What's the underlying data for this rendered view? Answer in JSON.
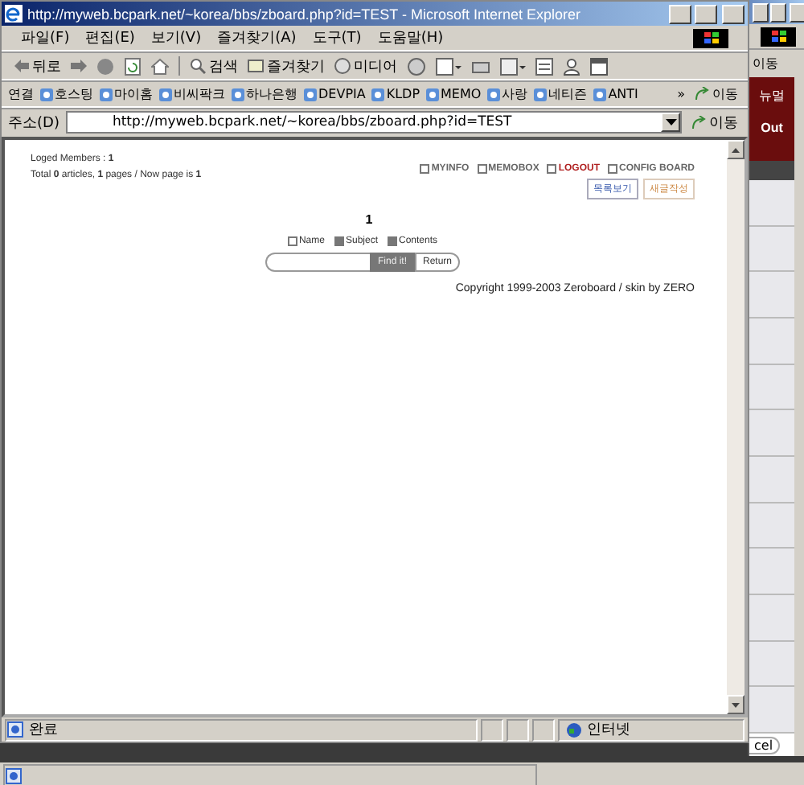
{
  "window": {
    "title": "http://myweb.bcpark.net/~korea/bbs/zboard.php?id=TEST - Microsoft Internet Explorer"
  },
  "menu": [
    "파일(F)",
    "편집(E)",
    "보기(V)",
    "즐겨찾기(A)",
    "도구(T)",
    "도움말(H)"
  ],
  "toolbar": {
    "back": "뒤로",
    "search": "검색",
    "favorites": "즐겨찾기",
    "media": "미디어"
  },
  "links": {
    "label": "연결",
    "items": [
      "호스팅",
      "마이홈",
      "비씨팍크",
      "하나은행",
      "DEVPIA",
      "KLDP",
      "MEMO",
      "사랑",
      "네티즌",
      "ANTI"
    ],
    "more": "»",
    "go": "이동"
  },
  "address": {
    "label": "주소(D)",
    "value": "http://myweb.bcpark.net/~korea/bbs/zboard.php?id=TEST",
    "go": "이동"
  },
  "board": {
    "members_label": "Loged Members :",
    "members": "1",
    "total": "Total",
    "articles": "0",
    "articles_label": "articles,",
    "pages": "1",
    "pages_label": "pages / Now page is",
    "page": "1",
    "nav": [
      {
        "label": "MYINFO",
        "kind": "plain"
      },
      {
        "label": "MEMOBOX",
        "kind": "plain"
      },
      {
        "label": "LOGOUT",
        "kind": "alert"
      },
      {
        "label": "CONFIG BOARD",
        "kind": "plain"
      }
    ],
    "buttons": [
      "목록보기",
      "새글작성"
    ],
    "current_page": "1",
    "filters": [
      {
        "label": "Name",
        "checked": false
      },
      {
        "label": "Subject",
        "checked": true
      },
      {
        "label": "Contents",
        "checked": true
      }
    ],
    "find": "Find it!",
    "return": "Return",
    "copyright": "Copyright 1999-2003 Zeroboard / skin by ZERO"
  },
  "status_bar": {
    "text": "완료",
    "zone": "인터넷"
  },
  "back_window": {
    "go": "이동",
    "tab": "뉴멀",
    "out": "Out",
    "cancel": "cel"
  }
}
